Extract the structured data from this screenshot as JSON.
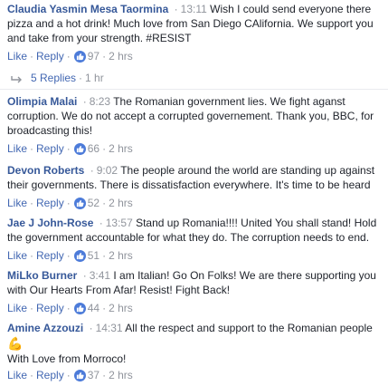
{
  "comments": [
    {
      "author": "Claudia Yasmin Mesa Taormina",
      "time": "13:11",
      "text": "Wish I could send everyone there pizza and a hot drink! Much love from San Diego CAlifornia. We support you and take from your strength. #RESIST",
      "like_label": "Like",
      "reply_label": "Reply",
      "reactions": "97",
      "age": "2 hrs",
      "replies_label": "5 Replies",
      "replies_age": "1 hr"
    },
    {
      "author": "Olimpia Malai",
      "time": "8:23",
      "text": "The Romanian government lies. We fight aganst corruption. We do not accept a corrupted governement. Thank you, BBC, for broadcasting this!",
      "like_label": "Like",
      "reply_label": "Reply",
      "reactions": "66",
      "age": "2 hrs"
    },
    {
      "author": "Devon Roberts",
      "time": "9:02",
      "text": "The people around the world are standing up against their governments. There is dissatisfaction everywhere. It's time to be heard",
      "like_label": "Like",
      "reply_label": "Reply",
      "reactions": "52",
      "age": "2 hrs"
    },
    {
      "author": "Jae J John-Rose",
      "time": "13:57",
      "text": "Stand up Romania!!!! United You shall stand! Hold the government accountable for what they do. The corruption needs to end.",
      "like_label": "Like",
      "reply_label": "Reply",
      "reactions": "51",
      "age": "2 hrs"
    },
    {
      "author": "MiLko Burner",
      "time": "3:41",
      "text": "I am Italian! Go On Folks! We are there supporting you with Our Hearts From Afar! Resist! Fight Back!",
      "like_label": "Like",
      "reply_label": "Reply",
      "reactions": "44",
      "age": "2 hrs"
    },
    {
      "author": "Amine Azzouzi",
      "time": "14:31",
      "text": "All the respect and support to the Romanian people",
      "emoji": "💪",
      "text_after": "With Love from Morroco!",
      "like_label": "Like",
      "reply_label": "Reply",
      "reactions": "37",
      "age": "2 hrs"
    }
  ],
  "colors": {
    "author": "#365899",
    "link": "#4267b2",
    "meta": "#90949c",
    "like_badge": "#4c7bd9",
    "divider": "#e9ebee"
  },
  "icons": {
    "reaction": "thumbs-up-icon",
    "replies": "reply-arrow-icon"
  }
}
